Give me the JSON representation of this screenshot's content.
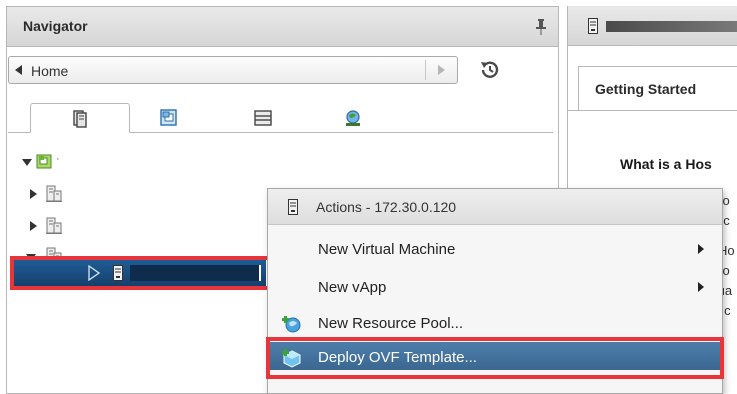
{
  "navigator": {
    "title": "Navigator",
    "home_label": "Home",
    "tabs": [
      {
        "name": "hosts-and-clusters",
        "icon": "hosts-clusters-icon",
        "active": true
      },
      {
        "name": "vms-and-templates",
        "icon": "vms-templates-icon",
        "active": false
      },
      {
        "name": "storage",
        "icon": "storage-icon",
        "active": false
      },
      {
        "name": "networking",
        "icon": "networking-icon",
        "active": false
      }
    ]
  },
  "right_panel": {
    "tab_label": "Getting Started",
    "heading": "What is a Hos",
    "fragments": [
      "co",
      "uc",
      "Ho",
      "so",
      "tua",
      "k c"
    ]
  },
  "context_menu": {
    "header": "Actions - 172.30.0.120",
    "items": [
      {
        "label": "New Virtual Machine",
        "submenu": true,
        "icon": ""
      },
      {
        "label": "New vApp",
        "submenu": true,
        "icon": ""
      },
      {
        "label": "New Resource Pool...",
        "submenu": false,
        "icon": "resource-pool-icon"
      },
      {
        "label": "Deploy OVF Template...",
        "submenu": false,
        "icon": "ovf-template-icon",
        "highlighted": true
      }
    ]
  },
  "colors": {
    "selection": "#1f5d95",
    "highlight": "#4d7eaa",
    "annotation_outline": "#e8343b"
  }
}
